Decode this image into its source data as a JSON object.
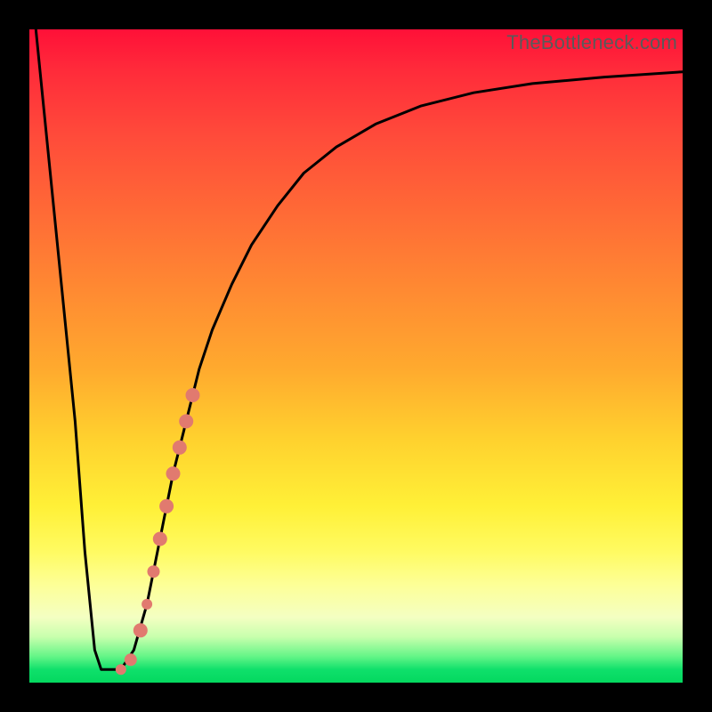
{
  "watermark": "TheBottleneck.com",
  "chart_data": {
    "type": "line",
    "title": "",
    "xlabel": "",
    "ylabel": "",
    "xlim": [
      0,
      100
    ],
    "ylim": [
      0,
      100
    ],
    "grid": false,
    "series": [
      {
        "name": "curve",
        "color": "#000000",
        "x": [
          1,
          3,
          5,
          7,
          8.5,
          10,
          11,
          12,
          14,
          16,
          18,
          20,
          22,
          24,
          26,
          28,
          31,
          34,
          38,
          42,
          47,
          53,
          60,
          68,
          77,
          88,
          100
        ],
        "y": [
          100,
          80,
          60,
          40,
          20,
          5,
          2,
          2,
          2,
          5,
          12,
          22,
          32,
          40,
          48,
          54,
          61,
          67,
          73,
          78,
          82,
          85.5,
          88.3,
          90.3,
          91.7,
          92.7,
          93.5
        ]
      }
    ],
    "highlight_band": {
      "name": "highlighted-segment",
      "color": "#e17a6f",
      "points": [
        {
          "x": 14.0,
          "y": 2.0,
          "r_css": 6
        },
        {
          "x": 15.5,
          "y": 3.5,
          "r_css": 7
        },
        {
          "x": 17.0,
          "y": 8.0,
          "r_css": 8
        },
        {
          "x": 18.0,
          "y": 12.0,
          "r_css": 6
        },
        {
          "x": 19.0,
          "y": 17.0,
          "r_css": 7
        },
        {
          "x": 20.0,
          "y": 22.0,
          "r_css": 8
        },
        {
          "x": 21.0,
          "y": 27.0,
          "r_css": 8
        },
        {
          "x": 22.0,
          "y": 32.0,
          "r_css": 8
        },
        {
          "x": 23.0,
          "y": 36.0,
          "r_css": 8
        },
        {
          "x": 24.0,
          "y": 40.0,
          "r_css": 8
        },
        {
          "x": 25.0,
          "y": 44.0,
          "r_css": 8
        }
      ]
    }
  }
}
